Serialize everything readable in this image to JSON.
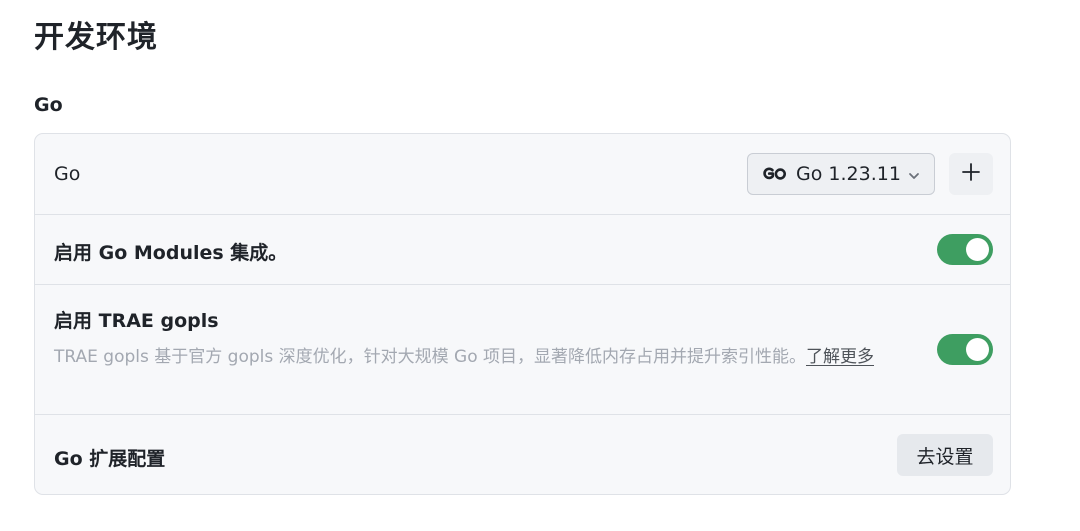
{
  "page": {
    "title": "开发环境"
  },
  "section": {
    "title": "Go"
  },
  "rows": {
    "go_version": {
      "label": "Go",
      "selected_version": "Go 1.23.11",
      "icon": "go-logo-icon",
      "add_icon": "plus-icon"
    },
    "modules": {
      "label": "启用 Go Modules 集成。",
      "enabled": true
    },
    "gopls": {
      "label": "启用 TRAE gopls",
      "description": "TRAE gopls 基于官方 gopls 深度优化，针对大规模 Go 项目，显著降低内存占用并提升索引性能。",
      "learn_more": "了解更多",
      "enabled": true
    },
    "extension": {
      "label": "Go 扩展配置",
      "button_label": "去设置"
    }
  },
  "colors": {
    "toggle_on": "#3e9e61",
    "card_bg": "#f7f8fa",
    "border": "#dfe2e7",
    "muted_text": "#a3a8b1"
  }
}
